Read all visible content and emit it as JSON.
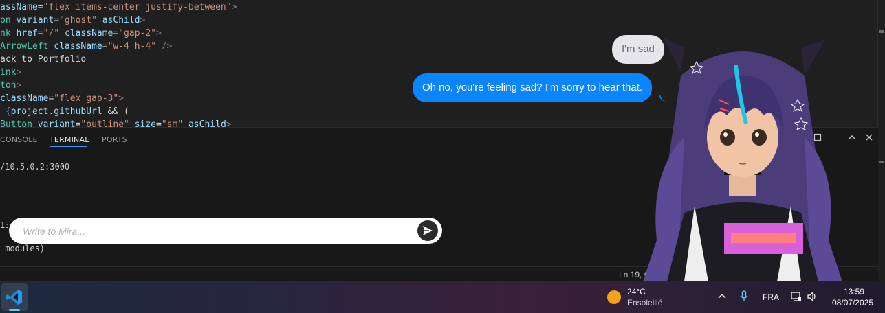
{
  "editor": {
    "lines": [
      [
        {
          "t": "assName",
          "c": "attr"
        },
        {
          "t": "=",
          "c": "txt"
        },
        {
          "t": "\"flex items-center justify-between\"",
          "c": "str"
        },
        {
          "t": ">",
          "c": "pun"
        }
      ],
      [
        {
          "t": "on ",
          "c": "tag"
        },
        {
          "t": "variant",
          "c": "attr"
        },
        {
          "t": "=",
          "c": "txt"
        },
        {
          "t": "\"ghost\"",
          "c": "str"
        },
        {
          "t": " ",
          "c": "txt"
        },
        {
          "t": "asChild",
          "c": "attr"
        },
        {
          "t": ">",
          "c": "pun"
        }
      ],
      [
        {
          "t": "nk ",
          "c": "tag"
        },
        {
          "t": "href",
          "c": "attr"
        },
        {
          "t": "=",
          "c": "txt"
        },
        {
          "t": "\"/\"",
          "c": "str"
        },
        {
          "t": " ",
          "c": "txt"
        },
        {
          "t": "className",
          "c": "attr"
        },
        {
          "t": "=",
          "c": "txt"
        },
        {
          "t": "\"gap-2\"",
          "c": "str"
        },
        {
          "t": ">",
          "c": "pun"
        }
      ],
      [
        {
          "t": "ArrowLeft ",
          "c": "tag"
        },
        {
          "t": "className",
          "c": "attr"
        },
        {
          "t": "=",
          "c": "txt"
        },
        {
          "t": "\"w-4 h-4\"",
          "c": "str"
        },
        {
          "t": " />",
          "c": "pun"
        }
      ],
      [
        {
          "t": "ack to Portfolio",
          "c": "txt"
        }
      ],
      [
        {
          "t": "ink",
          "c": "tag"
        },
        {
          "t": ">",
          "c": "pun"
        }
      ],
      [
        {
          "t": "ton",
          "c": "tag"
        },
        {
          "t": ">",
          "c": "pun"
        }
      ],
      [
        {
          "t": "className",
          "c": "attr"
        },
        {
          "t": "=",
          "c": "txt"
        },
        {
          "t": "\"flex gap-3\"",
          "c": "str"
        },
        {
          "t": ">",
          "c": "pun"
        }
      ],
      [
        {
          "t": " {",
          "c": "kw"
        },
        {
          "t": "project",
          "c": "attr"
        },
        {
          "t": ".",
          "c": "txt"
        },
        {
          "t": "githubUrl",
          "c": "attr"
        },
        {
          "t": " && (",
          "c": "txt"
        }
      ],
      [
        {
          "t": "Button ",
          "c": "tag"
        },
        {
          "t": "variant",
          "c": "attr"
        },
        {
          "t": "=",
          "c": "txt"
        },
        {
          "t": "\"outline\"",
          "c": "str"
        },
        {
          "t": " ",
          "c": "txt"
        },
        {
          "t": "size",
          "c": "attr"
        },
        {
          "t": "=",
          "c": "txt"
        },
        {
          "t": "\"sm\"",
          "c": "str"
        },
        {
          "t": " ",
          "c": "txt"
        },
        {
          "t": "asChild",
          "c": "attr"
        },
        {
          "t": ">",
          "c": "pun"
        }
      ]
    ]
  },
  "panel": {
    "tabs": [
      {
        "label": "CONSOLE",
        "active": false
      },
      {
        "label": "TERMINAL",
        "active": true
      },
      {
        "label": "PORTS",
        "active": false
      }
    ],
    "terminal_lines": {
      "line1": "/10.5.0.2:3000",
      "line2": "131",
      "line3": " modules)"
    }
  },
  "statusbar": {
    "position": "Ln 19, Col"
  },
  "chat": {
    "user_message": "I'm sad",
    "bot_message": "Oh no, you're feeling sad? I'm sorry to hear that.",
    "input_placeholder": "Write to Mira...",
    "input_value": "",
    "user_bubble_color": "#e5e5ea",
    "bot_bubble_color": "#0a84ff"
  },
  "taskbar": {
    "weather_temp": "24°C",
    "weather_desc": "Ensoleillé",
    "language": "FRA",
    "time": "13:59",
    "date": "08/07/2025"
  },
  "colors": {
    "accent": "#3794ff",
    "editor_bg": "#1f1f1f",
    "panel_bg": "#181818"
  }
}
